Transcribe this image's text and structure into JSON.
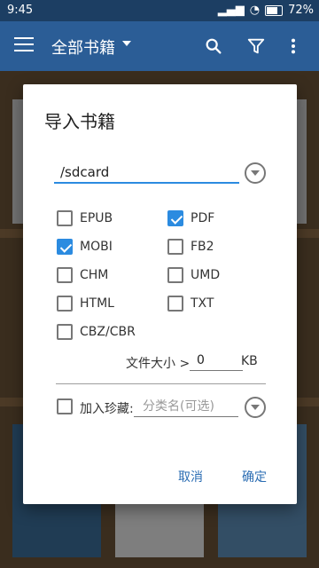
{
  "status_bar": {
    "time": "9:45",
    "battery": "72%"
  },
  "app_bar": {
    "title": "全部书籍"
  },
  "dialog": {
    "title": "导入书籍",
    "path": "/sdcard",
    "formats": [
      {
        "label": "EPUB",
        "checked": false
      },
      {
        "label": "PDF",
        "checked": true
      },
      {
        "label": "MOBI",
        "checked": true
      },
      {
        "label": "FB2",
        "checked": false
      },
      {
        "label": "CHM",
        "checked": false
      },
      {
        "label": "UMD",
        "checked": false
      },
      {
        "label": "HTML",
        "checked": false
      },
      {
        "label": "TXT",
        "checked": false
      },
      {
        "label": "CBZ/CBR",
        "checked": false
      }
    ],
    "size_label": "文件大小 >",
    "size_value": "0",
    "size_unit": "KB",
    "favorite_label": "加入珍藏:",
    "favorite_checked": false,
    "category_placeholder": "分类名(可选)",
    "cancel": "取消",
    "confirm": "确定"
  },
  "colors": {
    "accent": "#2b8be0",
    "app_bar": "#2b5d96",
    "status_bar": "#1c3e63"
  }
}
